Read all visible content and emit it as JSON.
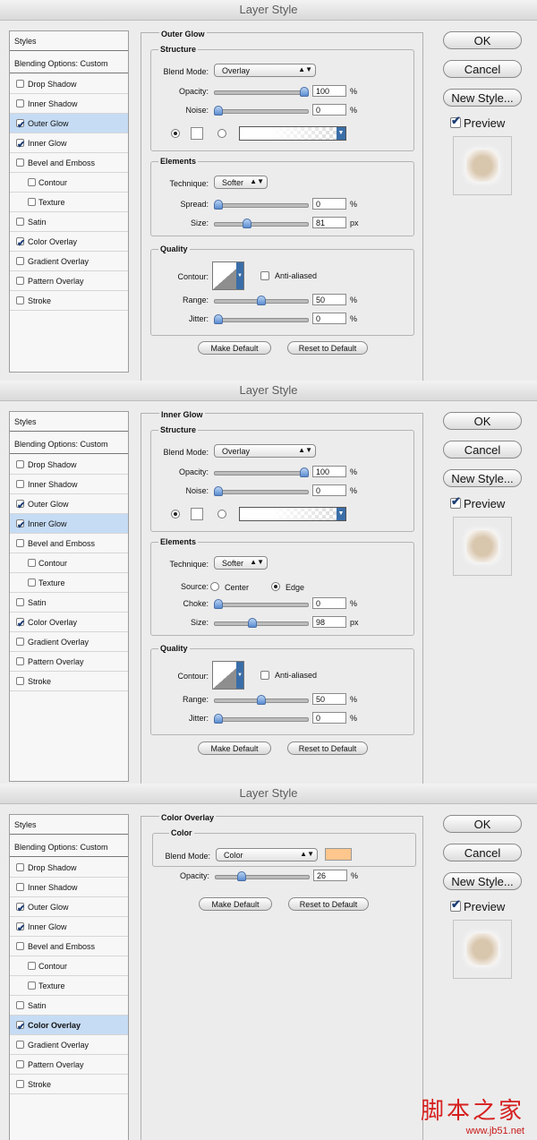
{
  "window_title": "Layer Style",
  "sidebar": {
    "header": "Styles",
    "blending": "Blending Options: Custom",
    "items": [
      {
        "label": "Drop Shadow"
      },
      {
        "label": "Inner Shadow"
      },
      {
        "label": "Outer Glow"
      },
      {
        "label": "Inner Glow"
      },
      {
        "label": "Bevel and Emboss"
      },
      {
        "label": "Contour"
      },
      {
        "label": "Texture"
      },
      {
        "label": "Satin"
      },
      {
        "label": "Color Overlay"
      },
      {
        "label": "Gradient Overlay"
      },
      {
        "label": "Pattern Overlay"
      },
      {
        "label": "Stroke"
      }
    ]
  },
  "buttons": {
    "ok": "OK",
    "cancel": "Cancel",
    "new_style": "New Style...",
    "preview": "Preview",
    "make_default": "Make Default",
    "reset_default": "Reset to Default"
  },
  "checkmark": "✔",
  "panel1": {
    "section": "Outer Glow",
    "structure": "Structure",
    "blend_label": "Blend Mode:",
    "blend_value": "Overlay",
    "opacity_label": "Opacity:",
    "opacity_value": "100",
    "opacity_level": 1.0,
    "noise_label": "Noise:",
    "noise_value": "0",
    "noise_level": 0.0,
    "elements": "Elements",
    "technique_label": "Technique:",
    "technique_value": "Softer",
    "spread_label": "Spread:",
    "spread_value": "0",
    "spread_level": 0.0,
    "size_label": "Size:",
    "size_value": "81",
    "size_unit": "px",
    "size_level": 0.33,
    "quality": "Quality",
    "contour_label": "Contour:",
    "anti_aliased": "Anti-aliased",
    "range_label": "Range:",
    "range_value": "50",
    "range_level": 0.5,
    "jitter_label": "Jitter:",
    "jitter_value": "0",
    "jitter_level": 0.0,
    "pct": "%"
  },
  "panel2": {
    "section": "Inner Glow",
    "structure": "Structure",
    "blend_label": "Blend Mode:",
    "blend_value": "Overlay",
    "opacity_label": "Opacity:",
    "opacity_value": "100",
    "opacity_level": 1.0,
    "noise_label": "Noise:",
    "noise_value": "0",
    "noise_level": 0.0,
    "elements": "Elements",
    "technique_label": "Technique:",
    "technique_value": "Softer",
    "source_label": "Source:",
    "source_center": "Center",
    "source_edge": "Edge",
    "choke_label": "Choke:",
    "choke_value": "0",
    "choke_level": 0.0,
    "size_label": "Size:",
    "size_value": "98",
    "size_unit": "px",
    "size_level": 0.4,
    "quality": "Quality",
    "contour_label": "Contour:",
    "anti_aliased": "Anti-aliased",
    "range_label": "Range:",
    "range_value": "50",
    "range_level": 0.5,
    "jitter_label": "Jitter:",
    "jitter_value": "0",
    "jitter_level": 0.0,
    "pct": "%"
  },
  "panel3": {
    "section": "Color Overlay",
    "color": "Color",
    "blend_label": "Blend Mode:",
    "blend_value": "Color",
    "overlay_color": "#fcc68c",
    "opacity_label": "Opacity:",
    "opacity_value": "26",
    "opacity_level": 0.26,
    "pct": "%"
  },
  "watermark": {
    "logo": "脚本之家",
    "url": "www.jb51.net"
  }
}
